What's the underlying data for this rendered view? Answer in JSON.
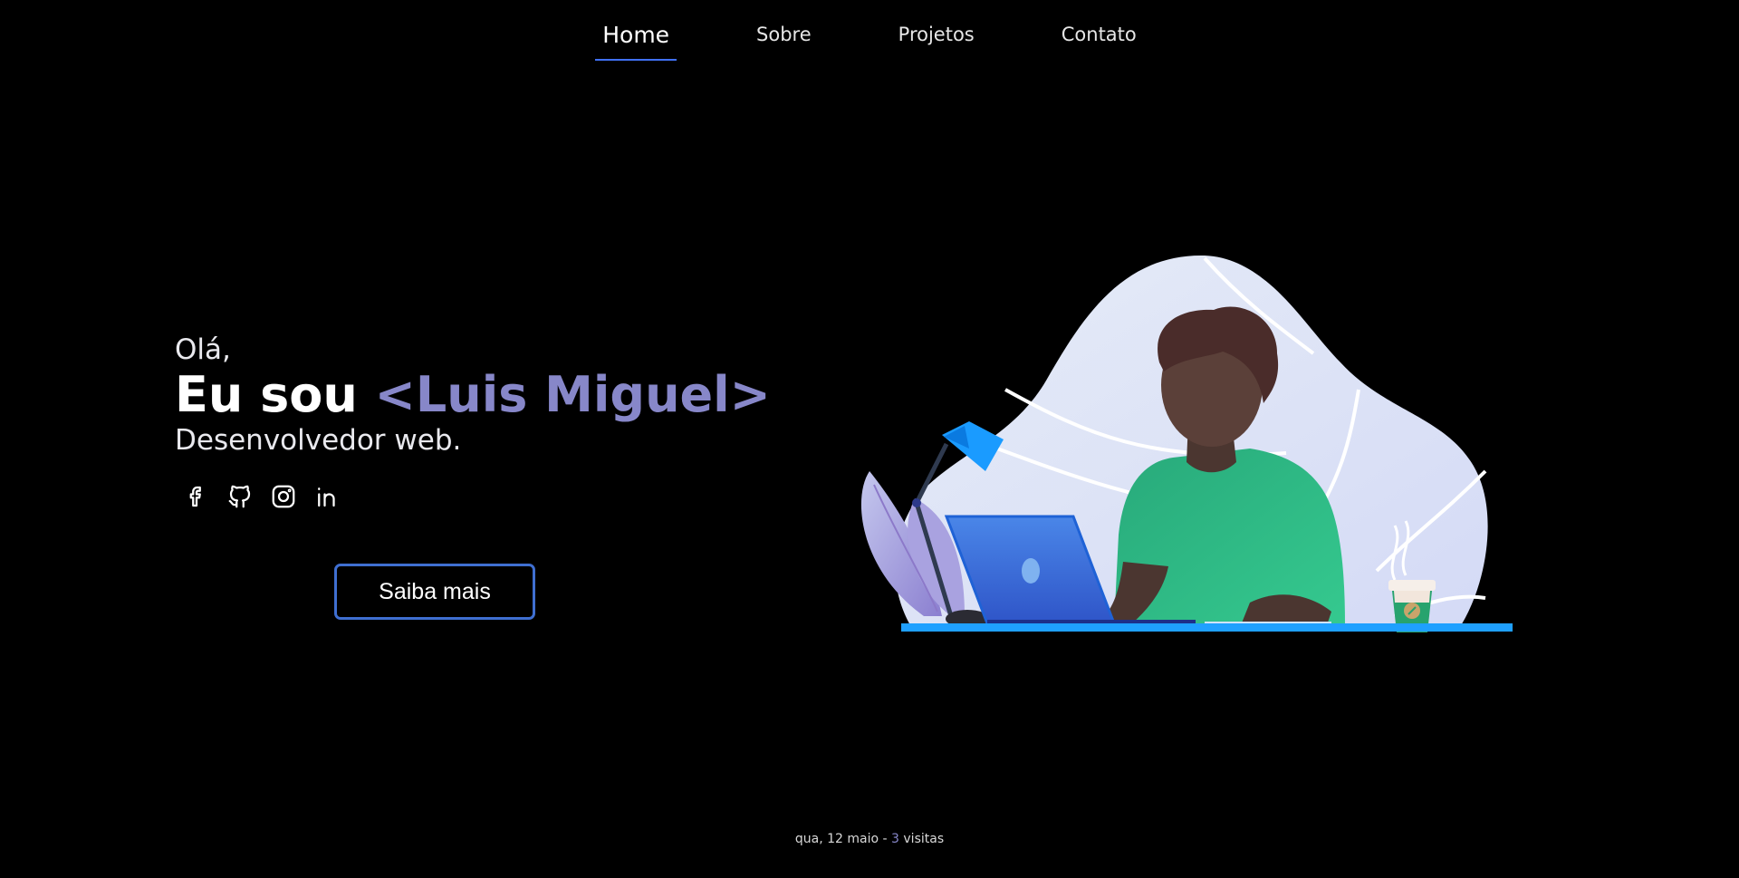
{
  "nav": {
    "items": [
      {
        "label": "Home",
        "active": true
      },
      {
        "label": "Sobre",
        "active": false
      },
      {
        "label": "Projetos",
        "active": false
      },
      {
        "label": "Contato",
        "active": false
      }
    ]
  },
  "hero": {
    "greeting": "Olá,",
    "title_prefix": "Eu sou ",
    "name": "<Luis Miguel>",
    "subtitle": "Desenvolvedor web.",
    "cta_label": "Saiba mais"
  },
  "social": [
    {
      "icon": "facebook-icon"
    },
    {
      "icon": "github-icon"
    },
    {
      "icon": "instagram-icon"
    },
    {
      "icon": "linkedin-icon"
    }
  ],
  "footer": {
    "date": "qua, 12 maio",
    "separator": " - ",
    "count": "3",
    "suffix": " visitas"
  },
  "colors": {
    "background": "#000000",
    "accent": "#8787c9",
    "button_border": "#3f6fd1",
    "nav_underline": "#4070f4"
  }
}
